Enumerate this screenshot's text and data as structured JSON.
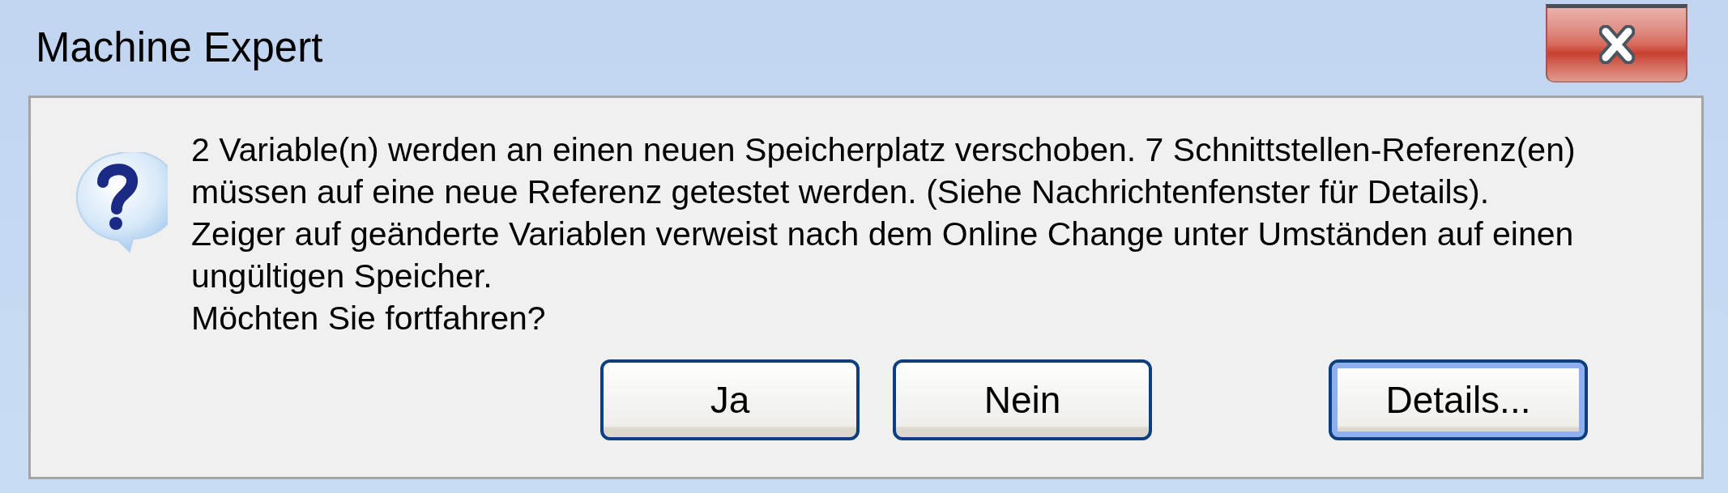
{
  "window": {
    "title": "Machine Expert"
  },
  "message": {
    "paragraphs": [
      "2 Variable(n) werden an einen neuen Speicherplatz verschoben. 7 Schnittstellen-Referenz(en) müssen auf eine neue Referenz getestet werden. (Siehe Nachrichtenfenster für Details).",
      "Zeiger auf geänderte Variablen verweist nach dem Online Change unter Umständen auf einen ungültigen Speicher.",
      "Möchten Sie fortfahren?"
    ]
  },
  "buttons": [
    {
      "label": "Ja",
      "focused": false
    },
    {
      "label": "Nein",
      "focused": false
    },
    {
      "label": "Details...",
      "focused": true
    }
  ]
}
